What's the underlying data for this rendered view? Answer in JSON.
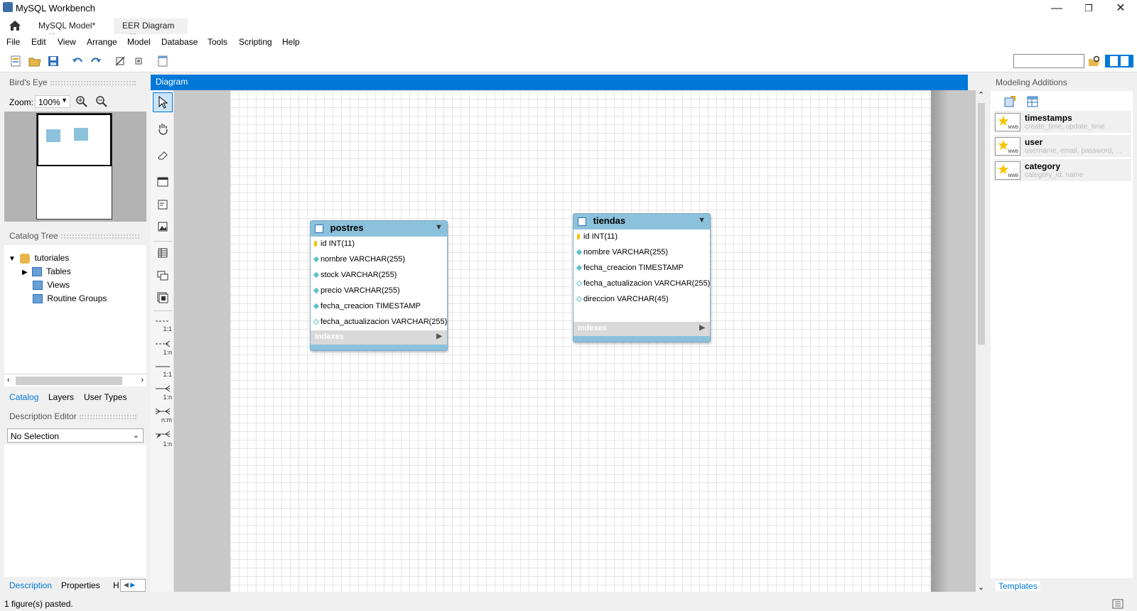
{
  "window": {
    "title": "MySQL Workbench"
  },
  "tabs": [
    {
      "label": "MySQL Model*",
      "close": "✕"
    },
    {
      "label": "EER Diagram",
      "close": "✕"
    }
  ],
  "menu": [
    "File",
    "Edit",
    "View",
    "Arrange",
    "Model",
    "Database",
    "Tools",
    "Scripting",
    "Help"
  ],
  "left": {
    "birdseye_title": "Bird's Eye",
    "zoom_label": "Zoom:",
    "zoom_value": "100%",
    "catalog_title": "Catalog Tree",
    "tree": {
      "root": "tutoriales",
      "children": [
        "Tables",
        "Views",
        "Routine Groups"
      ]
    },
    "catalog_tabs": [
      "Catalog",
      "Layers",
      "User Types"
    ],
    "desc_title": "Description Editor",
    "desc_select": "No Selection",
    "bottom_tabs": [
      "Description",
      "Properties",
      "H"
    ]
  },
  "diagram": {
    "title": "Diagram",
    "tool_labels": [
      "1:1",
      "1:n",
      "1:1",
      "1:n",
      "n:m",
      "1:n"
    ],
    "tables": [
      {
        "name": "postres",
        "columns": [
          {
            "text": "id INT(11)",
            "marker": "key"
          },
          {
            "text": "nombre VARCHAR(255)",
            "marker": "filled"
          },
          {
            "text": "stock VARCHAR(255)",
            "marker": "filled"
          },
          {
            "text": "precio VARCHAR(255)",
            "marker": "filled"
          },
          {
            "text": "fecha_creacion TIMESTAMP",
            "marker": "filled"
          },
          {
            "text": "fecha_actualizacion VARCHAR(255)",
            "marker": "hollow"
          }
        ],
        "indexes": "Indexes"
      },
      {
        "name": "tiendas",
        "columns": [
          {
            "text": "id INT(11)",
            "marker": "key"
          },
          {
            "text": "nombre VARCHAR(255)",
            "marker": "filled"
          },
          {
            "text": "fecha_creacion TIMESTAMP",
            "marker": "filled"
          },
          {
            "text": "fecha_actualizacion VARCHAR(255)",
            "marker": "hollow"
          },
          {
            "text": "direccion VARCHAR(45)",
            "marker": "hollow"
          }
        ],
        "indexes": "Indexes"
      }
    ]
  },
  "right": {
    "title": "Modeling Additions",
    "templates": [
      {
        "name": "timestamps",
        "sub": "create_time, update_time",
        "icon_label": "MWB"
      },
      {
        "name": "user",
        "sub": "username, email, password, ...",
        "icon_label": "MWB"
      },
      {
        "name": "category",
        "sub": "category_id, name",
        "icon_label": "MWB"
      }
    ],
    "bottom_tab": "Templates"
  },
  "status": {
    "text": "1 figure(s) pasted."
  },
  "colors": {
    "accent": "#0078d7",
    "table_head": "#8cc1dc",
    "key": "#f5c400",
    "column_marker": "#5fc0c8"
  }
}
